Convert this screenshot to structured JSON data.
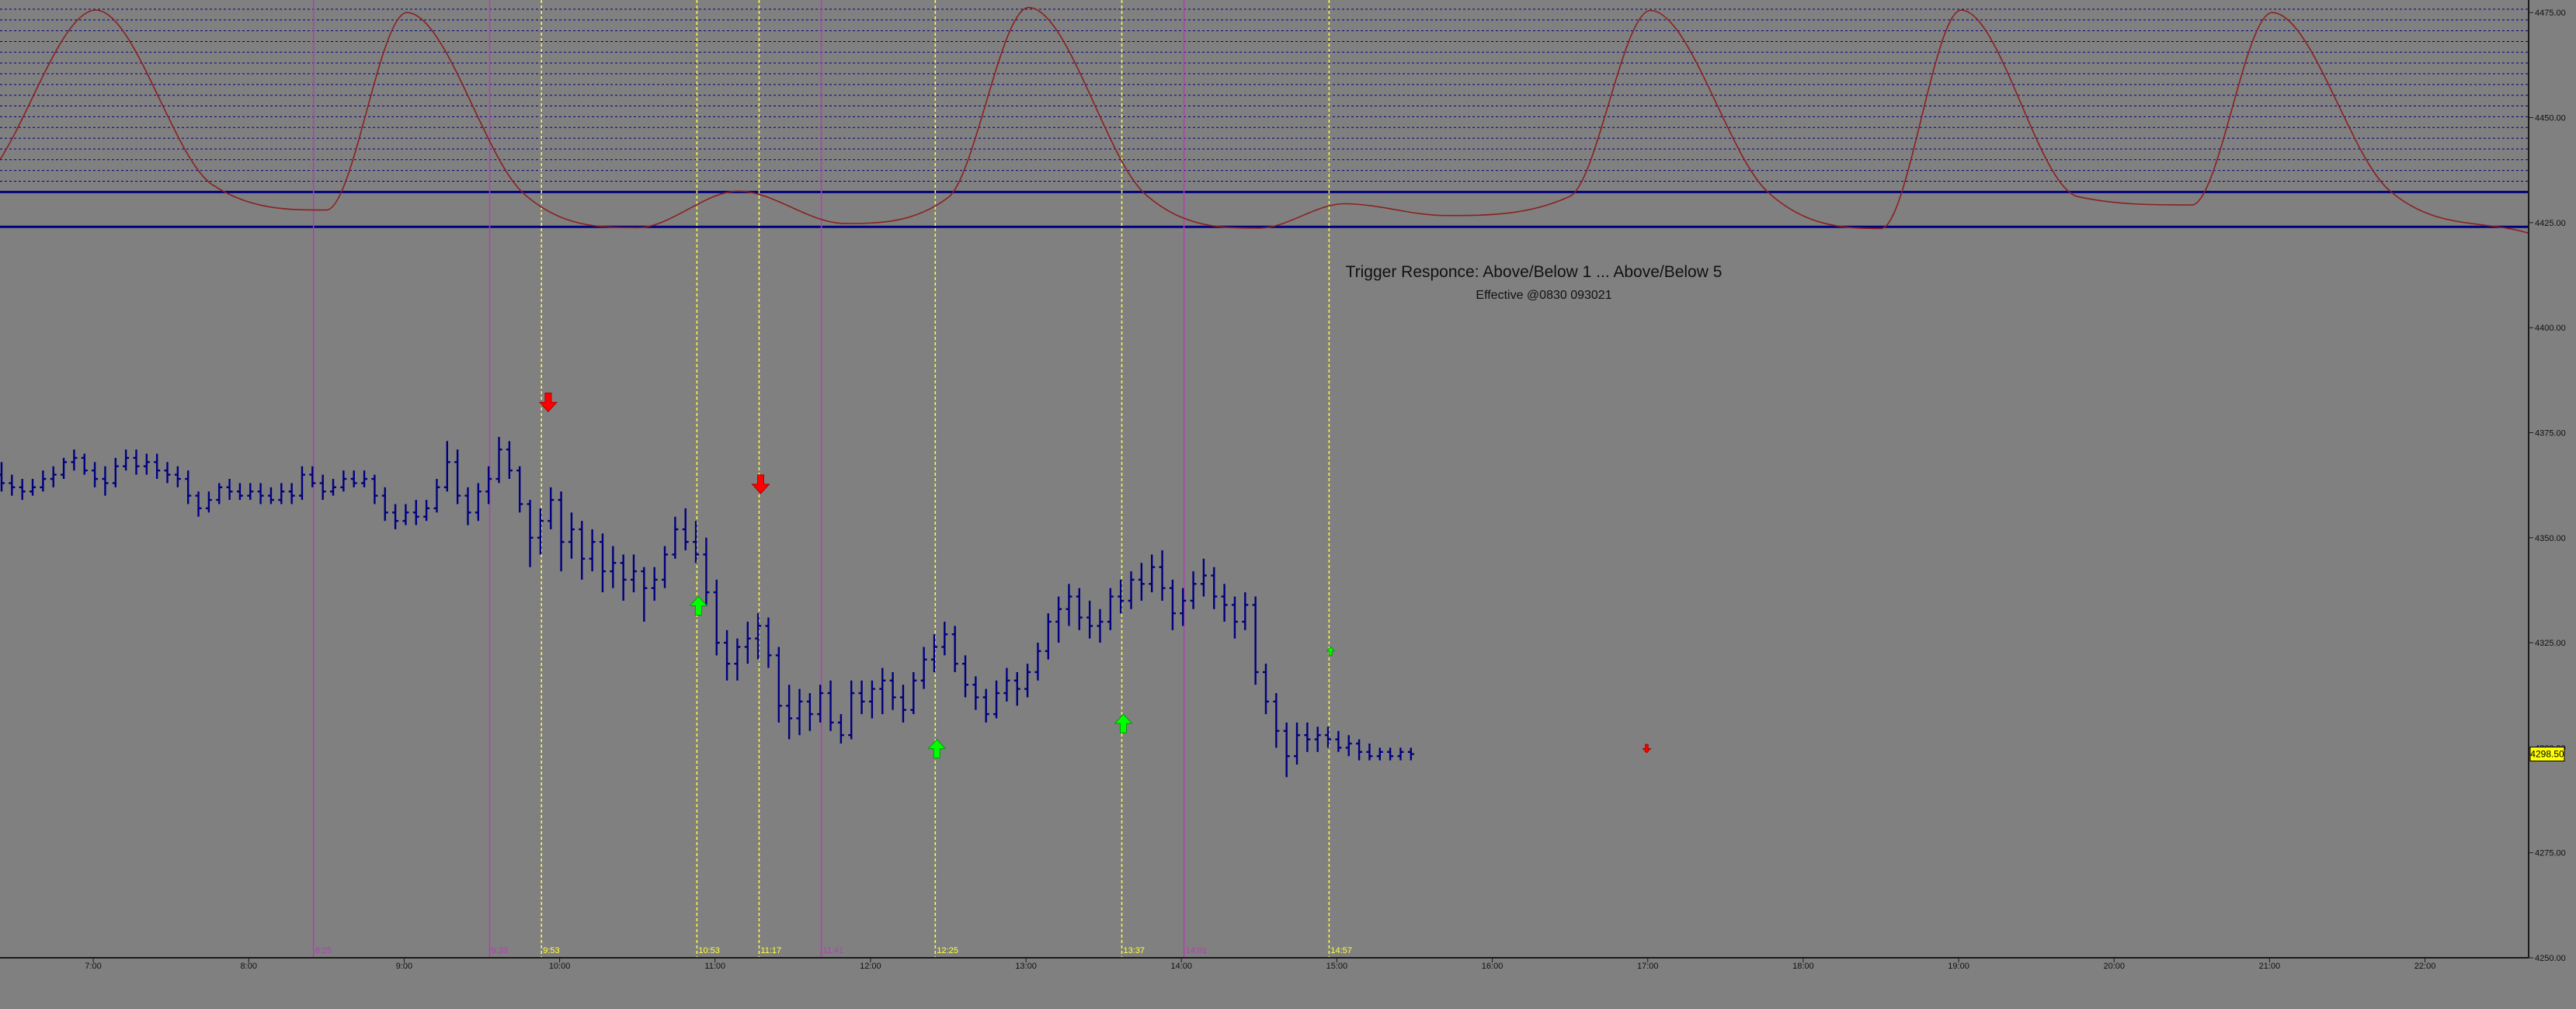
{
  "chart_data": {
    "type": "bar",
    "subtype": "ohlc-price-chart",
    "title": "Trigger Responce: Above/Below 1 ... Above/Below 5",
    "subtitle": "Effective @0830 093021",
    "x_axis": {
      "type": "time",
      "range": [
        "6:24",
        "22:40"
      ],
      "tick_labels": [
        "7:00",
        "8:00",
        "9:00",
        "10:00",
        "11:00",
        "12:00",
        "13:00",
        "14:00",
        "15:00",
        "16:00",
        "17:00",
        "18:00",
        "19:00",
        "20:00",
        "21:00",
        "22:00"
      ]
    },
    "y_axis": {
      "range": [
        4250,
        4478
      ],
      "position": "right",
      "ticks": [
        4250,
        4275,
        4300,
        4325,
        4350,
        4375,
        4400,
        4425,
        4450,
        4475
      ],
      "tick_labels": [
        "4250.00",
        "4275.00",
        "4300.00",
        "4325.00",
        "4350.00",
        "4375.00",
        "4400.00",
        "4425.00",
        "4450.00",
        "4475.00"
      ]
    },
    "last_price": {
      "value": 4298.5,
      "label": "4298.50",
      "box_color": "#ffff00"
    },
    "colors": {
      "background": "#808080",
      "bars": "#00007f",
      "oscillator": "#8b2020",
      "time_line_magenta": "#b040b0",
      "time_line_yellow": "#ffff40",
      "arrow_up": "#00ff00",
      "arrow_down": "#ff0000",
      "level_lines": "#00007f"
    },
    "time_markers": [
      {
        "time": "8:25",
        "label": "8:25",
        "style": "solid",
        "color": "magenta"
      },
      {
        "time": "9:33",
        "label": "9:33",
        "style": "solid",
        "color": "magenta"
      },
      {
        "time": "9:53",
        "label": "9:53",
        "style": "dotted",
        "color": "yellow"
      },
      {
        "time": "10:53",
        "label": "10:53",
        "style": "dotted",
        "color": "yellow"
      },
      {
        "time": "11:17",
        "label": "11:17",
        "style": "dotted",
        "color": "yellow"
      },
      {
        "time": "11:41",
        "label": "11:41",
        "style": "solid",
        "color": "magenta"
      },
      {
        "time": "12:25",
        "label": "12:25",
        "style": "dotted",
        "color": "yellow"
      },
      {
        "time": "13:37",
        "label": "13:37",
        "style": "dotted",
        "color": "yellow"
      },
      {
        "time": "14:01",
        "label": "14:01",
        "style": "solid",
        "color": "magenta"
      },
      {
        "time": "14:57",
        "label": "14:57",
        "style": "dotted",
        "color": "yellow"
      }
    ],
    "level_lines": {
      "thick": [
        4432.3,
        4424
      ],
      "dotted_from": 4432.3,
      "dotted_to": 4475.8,
      "dotted_count": 18
    },
    "signals": [
      {
        "time": "9:55",
        "price": 4380,
        "type": "sell"
      },
      {
        "time": "10:53",
        "price": 4336,
        "type": "buy"
      },
      {
        "time": "11:17",
        "price": 4360.5,
        "type": "sell"
      },
      {
        "time": "12:25",
        "price": 4302,
        "type": "buy"
      },
      {
        "time": "13:37",
        "price": 4308,
        "type": "buy"
      },
      {
        "time": "14:57",
        "price": 4324,
        "type": "buy-small"
      },
      {
        "time": "16:59",
        "price": 4298.8,
        "type": "sell-small"
      }
    ],
    "oscillator_series": {
      "name": "",
      "x": [
        "6:24",
        "7:01",
        "7:46",
        "8:30",
        "9:01",
        "9:46",
        "10:30",
        "11:09",
        "11:50",
        "12:30",
        "13:01",
        "13:46",
        "14:30",
        "15:03",
        "15:42",
        "16:30",
        "17:01",
        "17:46",
        "18:30",
        "19:01",
        "19:46",
        "20:30",
        "21:01",
        "21:46",
        "22:40"
      ],
      "y": [
        4440,
        4475.6,
        4434,
        4428,
        4475,
        4432,
        4423.8,
        4432.5,
        4424.8,
        4431,
        4476.2,
        4431.8,
        4423.7,
        4429.5,
        4426.7,
        4431.3,
        4475.5,
        4432.5,
        4423.6,
        4475.6,
        4431.2,
        4429.2,
        4475,
        4432.8,
        4422.5
      ]
    },
    "series": [
      {
        "name": "",
        "bar_interval_minutes": 4,
        "first_bar_time": "6:24",
        "ohlc": [
          [
            4365,
            4368,
            4361,
            4363
          ],
          [
            4363,
            4365,
            4360,
            4362
          ],
          [
            4362,
            4364,
            4359,
            4361
          ],
          [
            4361,
            4364,
            4360,
            4362
          ],
          [
            4362,
            4366,
            4361,
            4364
          ],
          [
            4364,
            4367,
            4362,
            4365
          ],
          [
            4365,
            4369,
            4364,
            4368
          ],
          [
            4368,
            4371,
            4366,
            4369
          ],
          [
            4369,
            4370,
            4365,
            4366
          ],
          [
            4366,
            4368,
            4362,
            4364
          ],
          [
            4364,
            4367,
            4360,
            4363
          ],
          [
            4363,
            4369,
            4362,
            4367
          ],
          [
            4367,
            4371,
            4366,
            4369
          ],
          [
            4369,
            4371,
            4365,
            4367
          ],
          [
            4367,
            4370,
            4365,
            4368
          ],
          [
            4368,
            4370,
            4364,
            4366
          ],
          [
            4366,
            4368,
            4363,
            4365
          ],
          [
            4365,
            4367,
            4362,
            4364
          ],
          [
            4364,
            4366,
            4358,
            4360
          ],
          [
            4360,
            4361,
            4355,
            4357
          ],
          [
            4357,
            4361,
            4356,
            4359
          ],
          [
            4359,
            4363,
            4358,
            4362
          ],
          [
            4362,
            4364,
            4359,
            4361
          ],
          [
            4361,
            4363,
            4359,
            4360
          ],
          [
            4360,
            4363,
            4359,
            4361
          ],
          [
            4361,
            4363,
            4358,
            4360
          ],
          [
            4360,
            4362,
            4358,
            4359
          ],
          [
            4359,
            4363,
            4358,
            4361
          ],
          [
            4361,
            4363,
            4358,
            4360
          ],
          [
            4360,
            4367,
            4359,
            4365
          ],
          [
            4365,
            4367,
            4362,
            4363
          ],
          [
            4363,
            4365,
            4359,
            4361
          ],
          [
            4361,
            4364,
            4360,
            4362
          ],
          [
            4362,
            4366,
            4361,
            4364
          ],
          [
            4364,
            4366,
            4362,
            4363
          ],
          [
            4363,
            4366,
            4362,
            4364
          ],
          [
            4364,
            4365,
            4358,
            4360
          ],
          [
            4360,
            4362,
            4354,
            4356
          ],
          [
            4356,
            4358,
            4352,
            4354
          ],
          [
            4354,
            4358,
            4353,
            4356
          ],
          [
            4356,
            4359,
            4353,
            4355
          ],
          [
            4355,
            4359,
            4354,
            4357
          ],
          [
            4357,
            4364,
            4356,
            4362
          ],
          [
            4362,
            4373,
            4361,
            4368
          ],
          [
            4368,
            4371,
            4358,
            4360
          ],
          [
            4360,
            4362,
            4353,
            4356
          ],
          [
            4356,
            4363,
            4354,
            4361
          ],
          [
            4361,
            4367,
            4358,
            4364
          ],
          [
            4364,
            4374,
            4363,
            4371
          ],
          [
            4371,
            4373,
            4364,
            4366
          ],
          [
            4366,
            4367,
            4356,
            4358
          ],
          [
            4358,
            4359,
            4343,
            4350
          ],
          [
            4350,
            4357,
            4346,
            4354
          ],
          [
            4354,
            4362,
            4352,
            4359
          ],
          [
            4359,
            4361,
            4342,
            4349
          ],
          [
            4349,
            4356,
            4345,
            4352
          ],
          [
            4352,
            4354,
            4340,
            4345
          ],
          [
            4345,
            4352,
            4342,
            4349
          ],
          [
            4349,
            4351,
            4337,
            4342
          ],
          [
            4342,
            4348,
            4338,
            4344
          ],
          [
            4344,
            4346,
            4335,
            4340
          ],
          [
            4340,
            4346,
            4337,
            4342
          ],
          [
            4342,
            4343,
            4330,
            4338
          ],
          [
            4338,
            4343,
            4335,
            4340
          ],
          [
            4340,
            4348,
            4338,
            4346
          ],
          [
            4346,
            4355,
            4345,
            4352
          ],
          [
            4352,
            4357,
            4347,
            4349
          ],
          [
            4349,
            4354,
            4344,
            4346
          ],
          [
            4346,
            4350,
            4334,
            4337
          ],
          [
            4337,
            4340,
            4322,
            4325
          ],
          [
            4325,
            4328,
            4316,
            4320
          ],
          [
            4320,
            4326,
            4316,
            4324
          ],
          [
            4324,
            4330,
            4320,
            4326
          ],
          [
            4326,
            4332,
            4321,
            4329
          ],
          [
            4329,
            4331,
            4319,
            4322
          ],
          [
            4322,
            4324,
            4306,
            4310
          ],
          [
            4310,
            4315,
            4302,
            4307
          ],
          [
            4307,
            4314,
            4303,
            4311
          ],
          [
            4311,
            4313,
            4304,
            4308
          ],
          [
            4308,
            4315,
            4306,
            4313
          ],
          [
            4313,
            4316,
            4304,
            4306
          ],
          [
            4306,
            4308,
            4301,
            4303
          ],
          [
            4303,
            4316,
            4302,
            4313
          ],
          [
            4313,
            4316,
            4308,
            4311
          ],
          [
            4311,
            4316,
            4307,
            4314
          ],
          [
            4314,
            4319,
            4308,
            4316
          ],
          [
            4316,
            4318,
            4309,
            4312
          ],
          [
            4312,
            4315,
            4306,
            4309
          ],
          [
            4309,
            4318,
            4308,
            4316
          ],
          [
            4316,
            4324,
            4314,
            4321
          ],
          [
            4321,
            4327,
            4318,
            4324
          ],
          [
            4324,
            4330,
            4322,
            4327
          ],
          [
            4327,
            4329,
            4318,
            4320
          ],
          [
            4320,
            4322,
            4312,
            4315
          ],
          [
            4315,
            4317,
            4309,
            4312
          ],
          [
            4312,
            4314,
            4306,
            4308
          ],
          [
            4308,
            4316,
            4307,
            4313
          ],
          [
            4313,
            4319,
            4311,
            4316
          ],
          [
            4316,
            4318,
            4310,
            4314
          ],
          [
            4314,
            4320,
            4312,
            4318
          ],
          [
            4318,
            4325,
            4316,
            4323
          ],
          [
            4323,
            4332,
            4321,
            4330
          ],
          [
            4330,
            4336,
            4325,
            4333
          ],
          [
            4333,
            4339,
            4329,
            4336
          ],
          [
            4336,
            4338,
            4328,
            4331
          ],
          [
            4331,
            4335,
            4326,
            4329
          ],
          [
            4329,
            4333,
            4325,
            4330
          ],
          [
            4330,
            4338,
            4328,
            4336
          ],
          [
            4336,
            4340,
            4332,
            4335
          ],
          [
            4335,
            4342,
            4333,
            4340
          ],
          [
            4340,
            4344,
            4335,
            4339
          ],
          [
            4339,
            4346,
            4337,
            4343
          ],
          [
            4343,
            4347,
            4335,
            4338
          ],
          [
            4338,
            4340,
            4328,
            4332
          ],
          [
            4332,
            4338,
            4329,
            4335
          ],
          [
            4335,
            4342,
            4333,
            4339
          ],
          [
            4339,
            4345,
            4336,
            4341
          ],
          [
            4341,
            4343,
            4333,
            4336
          ],
          [
            4336,
            4339,
            4330,
            4334
          ],
          [
            4334,
            4336,
            4326,
            4330
          ],
          [
            4330,
            4337,
            4328,
            4334
          ],
          [
            4334,
            4336,
            4315,
            4318
          ],
          [
            4318,
            4320,
            4308,
            4311
          ],
          [
            4311,
            4313,
            4300,
            4304
          ],
          [
            4304,
            4306,
            4293,
            4298
          ],
          [
            4298,
            4306,
            4296,
            4303
          ],
          [
            4303,
            4306,
            4299,
            4302
          ],
          [
            4302,
            4305,
            4299,
            4303
          ],
          [
            4303,
            4305,
            4300,
            4302
          ],
          [
            4302,
            4304,
            4299,
            4300
          ],
          [
            4300,
            4303,
            4298,
            4301
          ],
          [
            4301,
            4302,
            4297,
            4299
          ],
          [
            4299,
            4301,
            4297,
            4298
          ],
          [
            4298,
            4300,
            4297,
            4299
          ],
          [
            4299,
            4300,
            4297,
            4298
          ],
          [
            4298,
            4300,
            4297,
            4299
          ],
          [
            4299,
            4300,
            4297,
            4298.5
          ]
        ]
      }
    ]
  }
}
